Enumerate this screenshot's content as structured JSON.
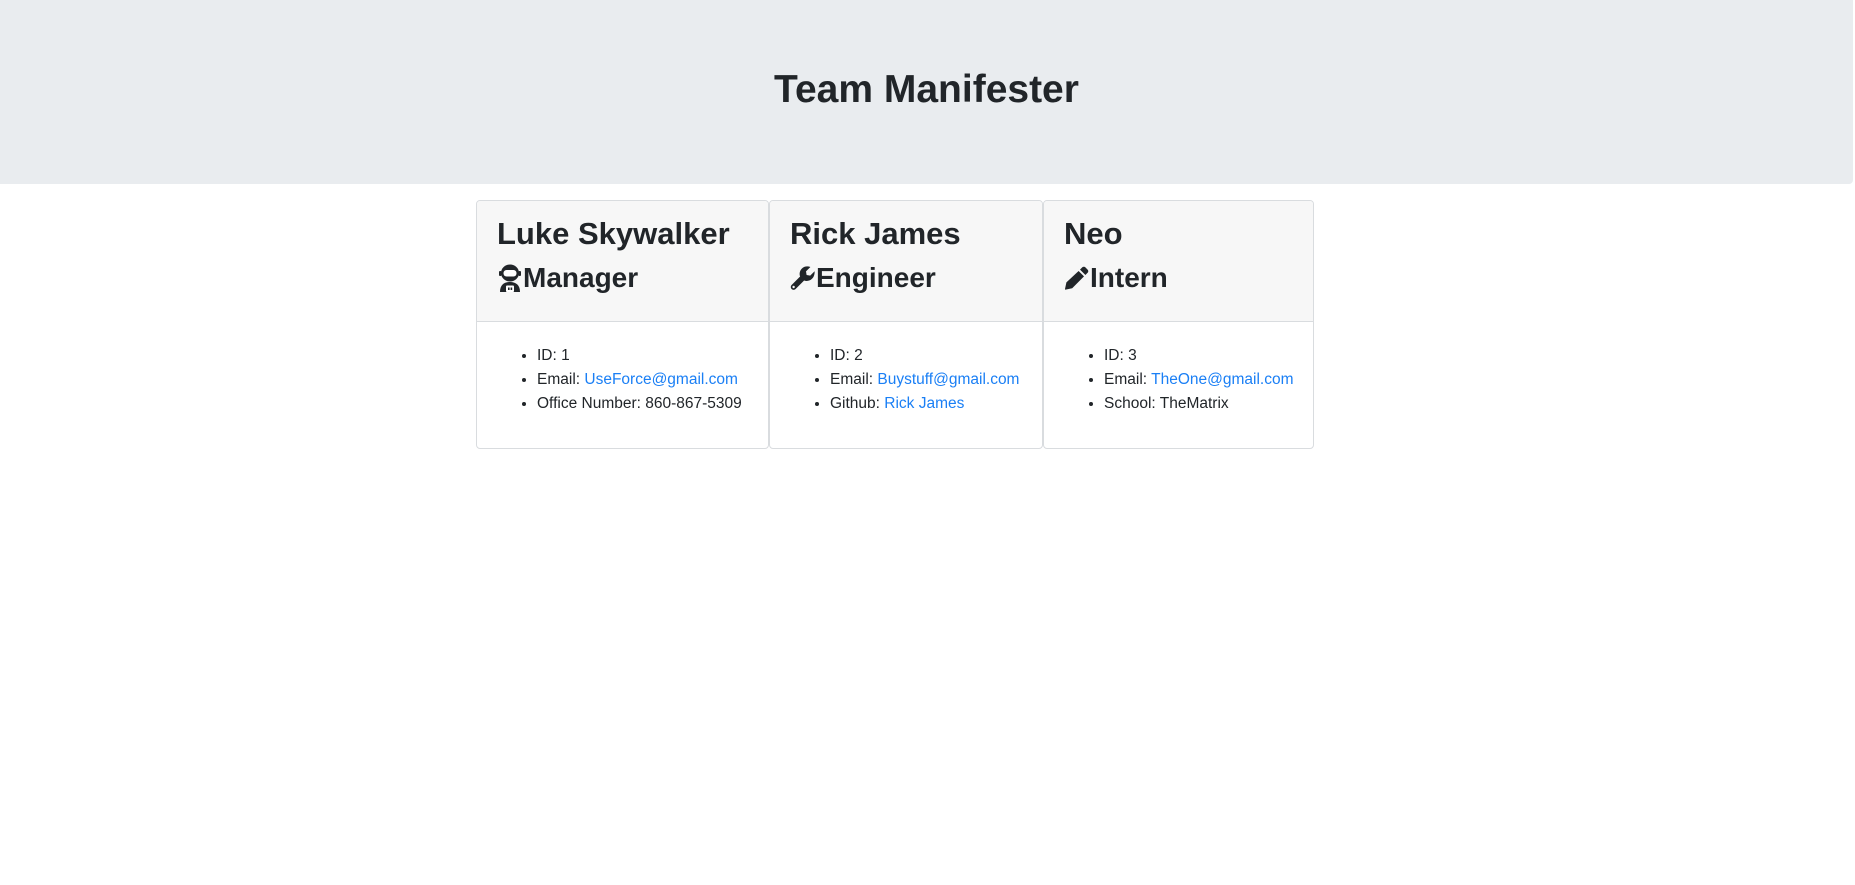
{
  "header": {
    "title": "Team Manifester"
  },
  "team": [
    {
      "name": "Luke Skywalker",
      "role": "Manager",
      "icon": "user-astronaut-icon",
      "id_label": "ID:",
      "id_value": "1",
      "email_label": "Email:",
      "email": "UseForce@gmail.com",
      "extra_label": "Office Number:",
      "extra_value": "860-867-5309"
    },
    {
      "name": "Rick James",
      "role": "Engineer",
      "icon": "wrench-icon",
      "id_label": "ID:",
      "id_value": "2",
      "email_label": "Email:",
      "email": "Buystuff@gmail.com",
      "extra_label": "Github:",
      "extra_value": "Rick James"
    },
    {
      "name": "Neo",
      "role": "Intern",
      "icon": "pencil-icon",
      "id_label": "ID:",
      "id_value": "3",
      "email_label": "Email:",
      "email": "TheOne@gmail.com",
      "extra_label": "School:",
      "extra_value": "TheMatrix"
    }
  ],
  "colors": {
    "header_bg": "#e9ecef",
    "card_header_bg": "#f7f7f7",
    "link": "#1a7ff5",
    "text": "#212529"
  }
}
